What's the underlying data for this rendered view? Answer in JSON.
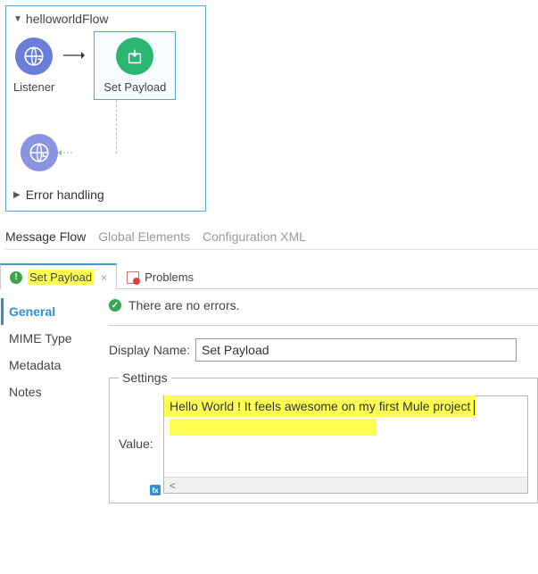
{
  "flow": {
    "name": "helloworldFlow",
    "listener_label": "Listener",
    "setpayload_label": "Set Payload",
    "error_section": "Error handling"
  },
  "canvas_tabs": {
    "message_flow": "Message Flow",
    "global_elements": "Global Elements",
    "config_xml": "Configuration XML"
  },
  "panel_tabs": {
    "set_payload": "Set Payload",
    "problems": "Problems"
  },
  "status": {
    "no_errors": "There are no errors."
  },
  "prop_sidebar": {
    "general": "General",
    "mime": "MIME Type",
    "metadata": "Metadata",
    "notes": "Notes"
  },
  "form": {
    "display_name_label": "Display Name:",
    "display_name_value": "Set Payload",
    "settings_legend": "Settings",
    "value_label": "Value:",
    "value_text": "Hello World ! It feels awesome on my first Mule project"
  }
}
